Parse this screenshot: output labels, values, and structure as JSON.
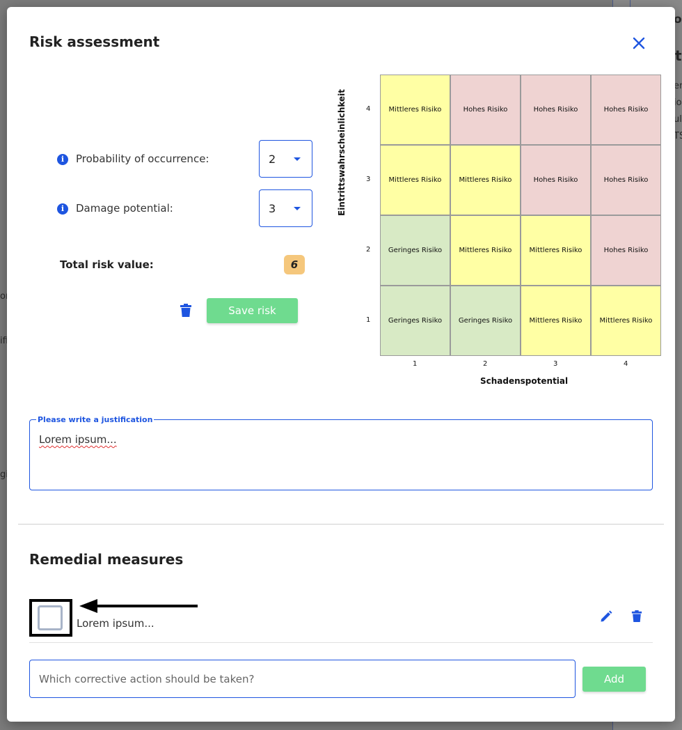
{
  "modal": {
    "title": "Risk assessment",
    "close_icon": "close-icon"
  },
  "background_fragments": [
    "o",
    "t",
    "en",
    "io",
    "ul",
    "TS",
    "or",
    "ifi",
    "gis"
  ],
  "form": {
    "probability": {
      "label": "Probability of occurrence:",
      "value": "2"
    },
    "damage": {
      "label": "Damage potential:",
      "value": "3"
    },
    "total_label": "Total risk value:",
    "total_value": "6",
    "save_label": "Save risk"
  },
  "matrix": {
    "y_title": "Eintrittswahrscheinlichkeit",
    "x_title": "Schadenspotential",
    "x_ticks": [
      "1",
      "2",
      "3",
      "4"
    ],
    "y_ticks": [
      "4",
      "3",
      "2",
      "1"
    ],
    "rows": [
      [
        "Mittleres Risiko",
        "Hohes Risiko",
        "Hohes Risiko",
        "Hohes Risiko"
      ],
      [
        "Mittleres Risiko",
        "Mittleres Risiko",
        "Hohes Risiko",
        "Hohes Risiko"
      ],
      [
        "Geringes Risiko",
        "Mittleres Risiko",
        "Mittleres Risiko",
        "Hohes Risiko"
      ],
      [
        "Geringes Risiko",
        "Geringes Risiko",
        "Mittleres Risiko",
        "Mittleres Risiko"
      ]
    ],
    "colors": {
      "Geringes Risiko": "#d8eac5",
      "Mittleres Risiko": "#ffffa4",
      "Hohes Risiko": "#efd3d2"
    }
  },
  "justification": {
    "legend": "Please write a justification",
    "value": "Lorem ipsum..."
  },
  "remedial": {
    "title": "Remedial measures",
    "items": [
      {
        "text": "Lorem ipsum...",
        "checked": false
      }
    ],
    "input_placeholder": "Which corrective action should be taken?",
    "add_label": "Add"
  },
  "colors": {
    "accent": "#1e55e0",
    "button_green": "#6fdb8f",
    "badge": "#f5c77c"
  }
}
